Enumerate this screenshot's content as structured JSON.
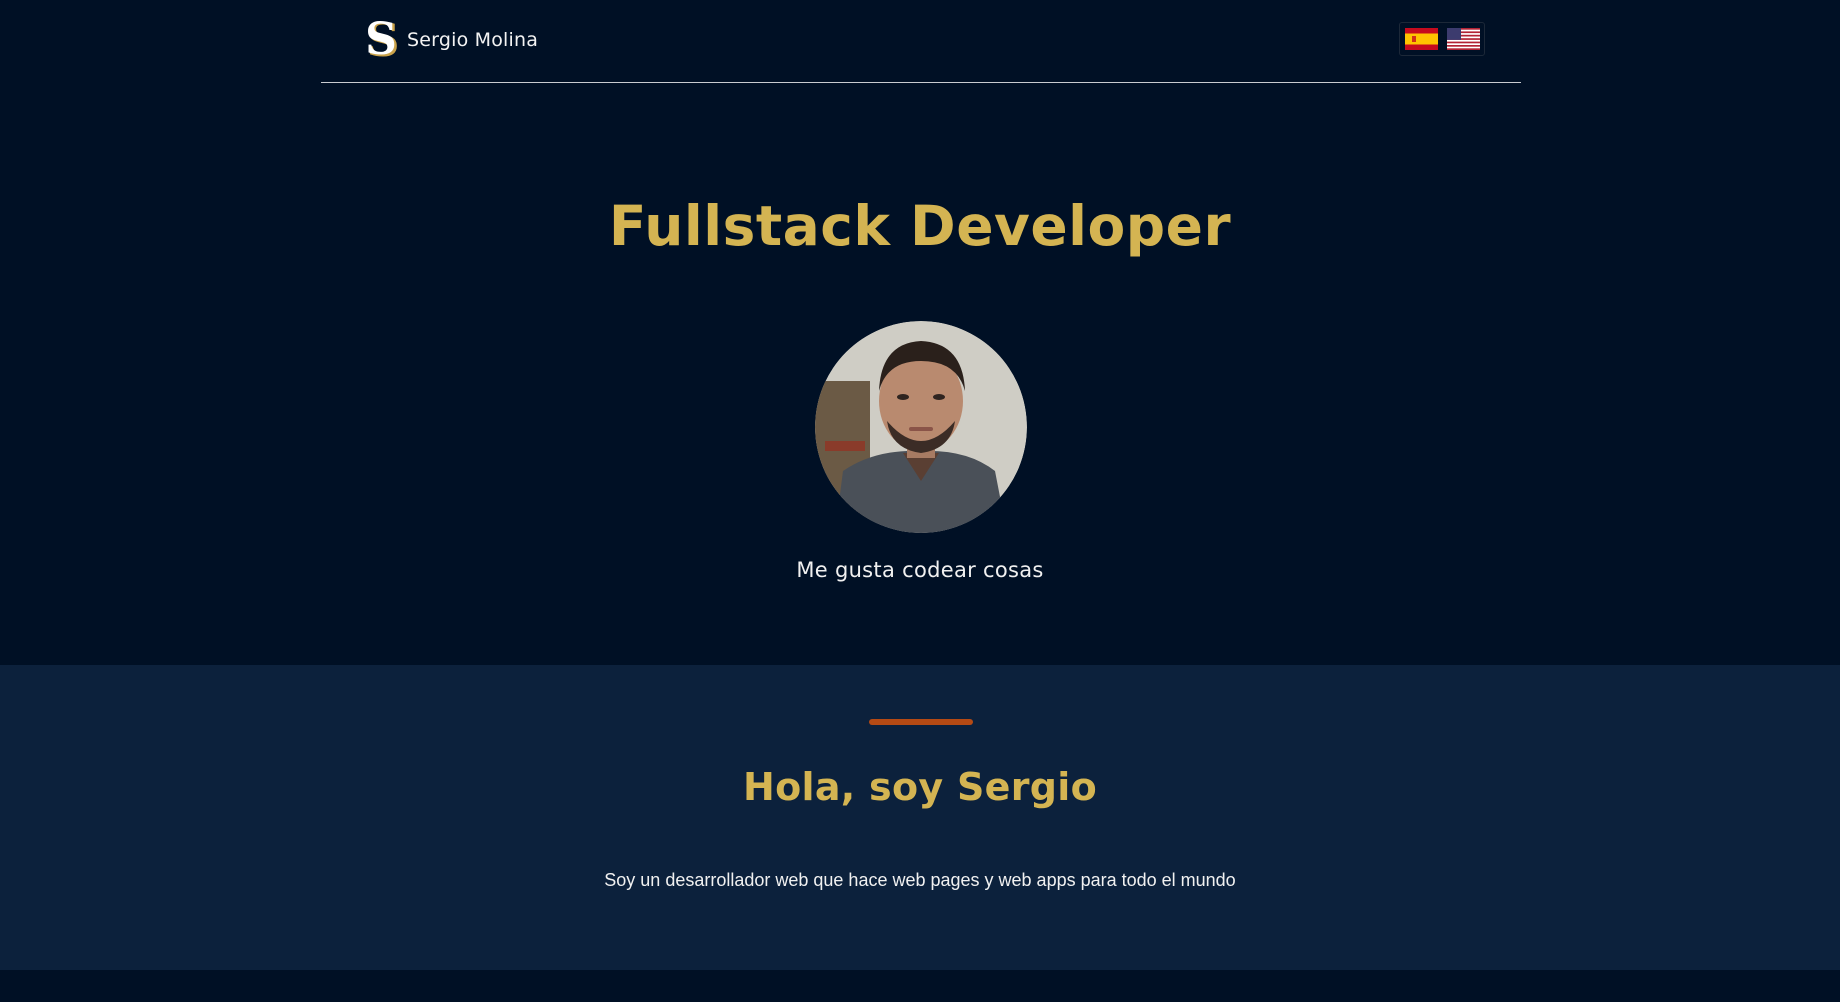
{
  "nav": {
    "brand_name": "Sergio Molina",
    "logo_letter": "S",
    "languages": [
      {
        "name": "Español",
        "icon": "spain-flag-icon"
      },
      {
        "name": "English",
        "icon": "usa-flag-icon"
      }
    ]
  },
  "hero": {
    "title": "Fullstack Developer",
    "tagline": "Me gusta codear cosas",
    "avatar_icon": "profile-photo"
  },
  "about": {
    "title": "Hola, soy Sergio",
    "text": "Soy un desarrollador web que hace web pages y web apps para todo el mundo"
  },
  "colors": {
    "background": "#001025",
    "section_background": "#0c213c",
    "accent_gold": "#d4b452",
    "divider_orange": "#b54a14"
  }
}
